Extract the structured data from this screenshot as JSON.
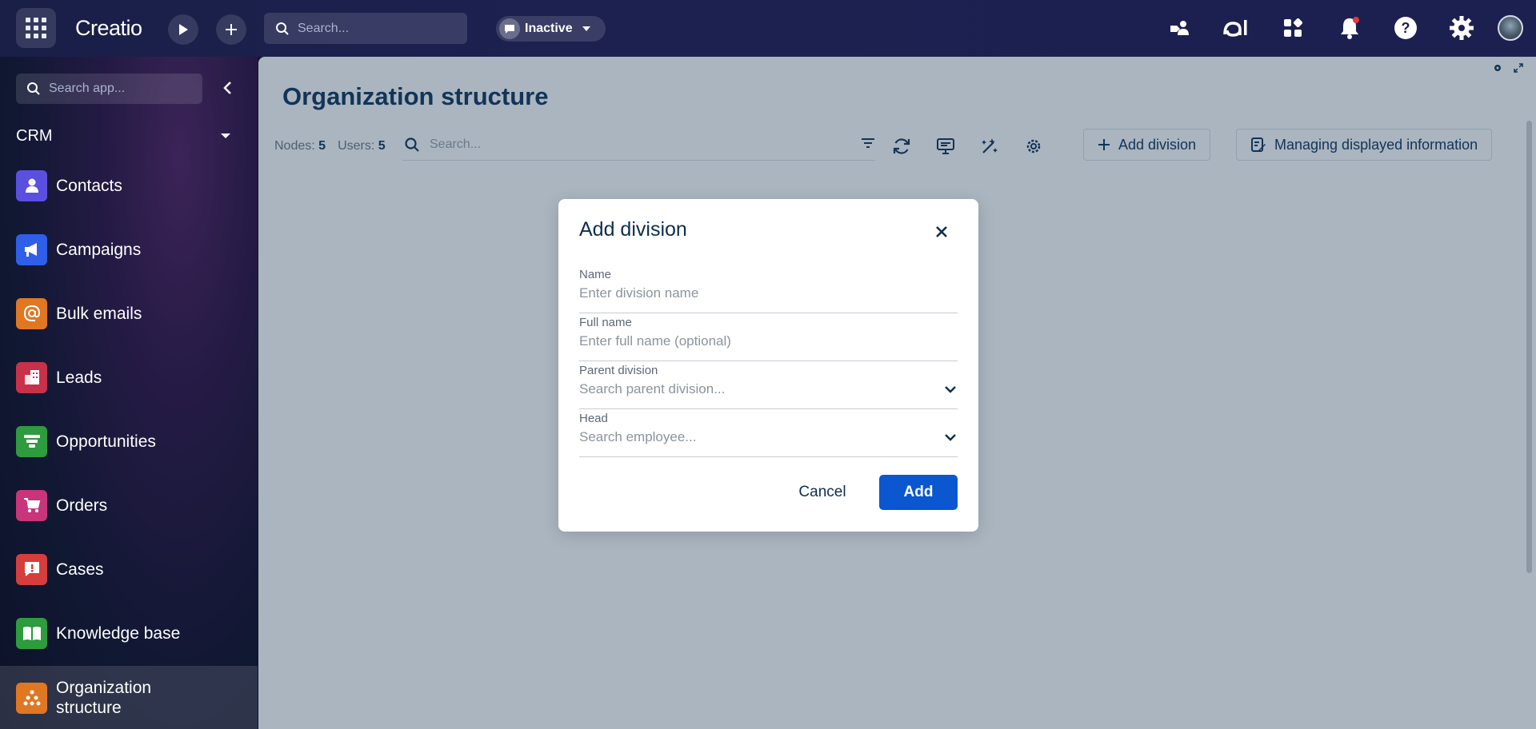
{
  "topbar": {
    "logo": "Creatio",
    "search_placeholder": "Search...",
    "status_label": "Inactive",
    "icons": [
      "apps-grid-icon",
      "play-icon",
      "plus-icon",
      "search-icon",
      "chat-icon",
      "chevron-down-icon",
      "handshake-icon",
      "ai-icon",
      "widgets-icon",
      "bell-icon",
      "help-icon",
      "gear-icon",
      "avatar"
    ],
    "notification_dot_color": "#e53935"
  },
  "sidebar": {
    "search_placeholder": "Search app...",
    "section_title": "CRM",
    "items": [
      {
        "label": "Contacts",
        "color": "#5b4fe0",
        "icon": "contacts-icon"
      },
      {
        "label": "Campaigns",
        "color": "#2f5ee8",
        "icon": "megaphone-icon"
      },
      {
        "label": "Bulk emails",
        "color": "#e07722",
        "icon": "at-icon"
      },
      {
        "label": "Leads",
        "color": "#c7314a",
        "icon": "leads-icon"
      },
      {
        "label": "Opportunities",
        "color": "#2d9b3e",
        "icon": "funnel-icon"
      },
      {
        "label": "Orders",
        "color": "#c8357a",
        "icon": "cart-icon"
      },
      {
        "label": "Cases",
        "color": "#d63d3d",
        "icon": "cases-icon"
      },
      {
        "label": "Knowledge base",
        "color": "#2d9b3e",
        "icon": "book-icon"
      },
      {
        "label": "Organization structure",
        "color": "#e07722",
        "icon": "org-structure-icon",
        "active": true
      }
    ]
  },
  "main": {
    "title": "Organization structure",
    "nodes_label": "Nodes:",
    "nodes_count": "5",
    "users_label": "Users:",
    "users_count": "5",
    "search_placeholder": "Search...",
    "add_division_label": "Add division",
    "managing_label": "Managing displayed information"
  },
  "dialog": {
    "title": "Add division",
    "fields": [
      {
        "label": "Name",
        "placeholder": "Enter division name"
      },
      {
        "label": "Full name",
        "placeholder": "Enter full name (optional)"
      },
      {
        "label": "Parent division",
        "placeholder": "Search parent division..."
      },
      {
        "label": "Head",
        "placeholder": "Search employee..."
      }
    ],
    "cancel_label": "Cancel",
    "add_label": "Add",
    "accent": "#0b57d0"
  }
}
